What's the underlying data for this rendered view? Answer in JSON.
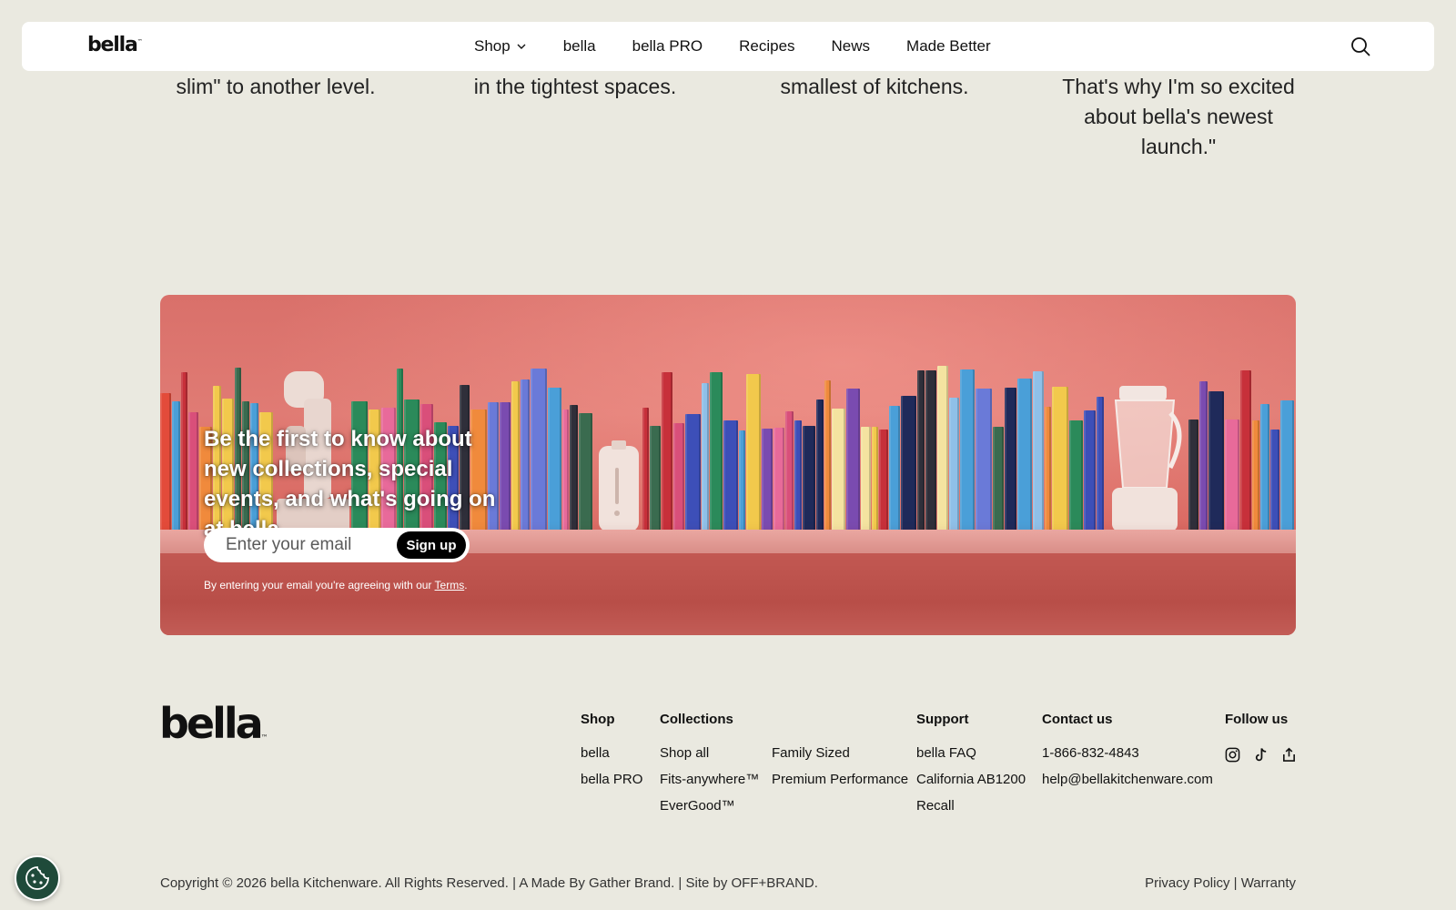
{
  "nav": {
    "logo": "bella",
    "logo_mark": "™",
    "links": [
      "Shop",
      "bella",
      "bella PRO",
      "Recipes",
      "News",
      "Made Better"
    ],
    "shop_has_dropdown": true,
    "search_icon": "search-icon"
  },
  "quotes": {
    "col1": "slim\" to another level.",
    "col2": "in the tightest spaces.",
    "col3": "smallest of kitchens.",
    "col4_line1": "That's why I'm so excited",
    "col4_line2": "about bella's newest",
    "col4_line3": "launch.\""
  },
  "newsletter": {
    "headline": "Be the first to know about new collections, special events, and what's going on at bella.",
    "email_placeholder": "Enter your email",
    "signup_label": "Sign up",
    "terms_prefix": "By entering your email you're agreeing with our ",
    "terms_link": "Terms",
    "terms_suffix": "."
  },
  "footer": {
    "logo": "bella",
    "logo_mark": "™",
    "shop": {
      "heading": "Shop",
      "items": [
        "bella",
        "bella PRO"
      ]
    },
    "collections": {
      "heading": "Collections",
      "col_a": [
        "Shop all",
        "Fits-anywhere™",
        "EverGood™"
      ],
      "col_b": [
        "Family Sized",
        "Premium Performance"
      ]
    },
    "support": {
      "heading": "Support",
      "items": [
        "bella FAQ",
        "California AB1200",
        "Recall"
      ]
    },
    "contact": {
      "heading": "Contact us",
      "items": [
        "1-866-832-4843",
        "help@bellakitchenware.com"
      ]
    },
    "follow": {
      "heading": "Follow us",
      "icons": [
        "instagram-icon",
        "tiktok-icon",
        "share-icon"
      ]
    },
    "copyright": "Copyright © 2026 bella Kitchenware. All Rights Reserved. | A Made By Gather Brand. | Site by OFF+BRAND.",
    "privacy": "Privacy Policy",
    "separator": "|",
    "warranty": "Warranty"
  },
  "colors": {
    "page_bg": "#eae9e0",
    "banner_coral": "#e07b74",
    "cookie_button": "#1f4a3a"
  }
}
